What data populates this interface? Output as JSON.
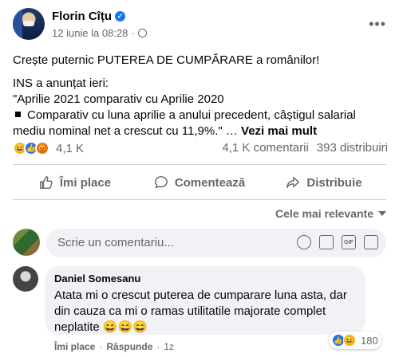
{
  "post": {
    "author": "Florin Cîțu",
    "date": "12 iunie la 08:28",
    "headline": "Crește puternic PUTEREA DE CUMPĂRARE a românilor!",
    "line1": "INS a anunțat ieri:",
    "line2": "\"Aprilie 2021 comparativ cu Aprilie 2020",
    "line3": "Comparativ cu luna aprilie a anului precedent, câștigul salarial mediu nominal net a crescut cu 11,9%.\" …",
    "see_more": "Vezi mai mult"
  },
  "stats": {
    "reaction_count": "4,1 K",
    "comments": "4,1 K comentarii",
    "shares": "393 distribuiri",
    "reactions": [
      "haha-icon",
      "like-icon",
      "angry-icon"
    ]
  },
  "actions": {
    "like": "Îmi place",
    "comment": "Comentează",
    "share": "Distribuie"
  },
  "sort_label": "Cele mai relevante",
  "composer": {
    "placeholder": "Scrie un comentariu..."
  },
  "comment": {
    "name": "Daniel Somesanu",
    "text": "Atata mi o crescut puterea de cumparare luna asta, dar din cauza ca mi o ramas utilitatile majorate complet neplatite 😄😄😄",
    "reactions_count": "180",
    "like": "Îmi place",
    "reply": "Răspunde",
    "time": "1z"
  },
  "colors": {
    "brand_blue": "#1877f2",
    "secondary_text": "#65676b",
    "bubble_bg": "#f0f2f5"
  }
}
